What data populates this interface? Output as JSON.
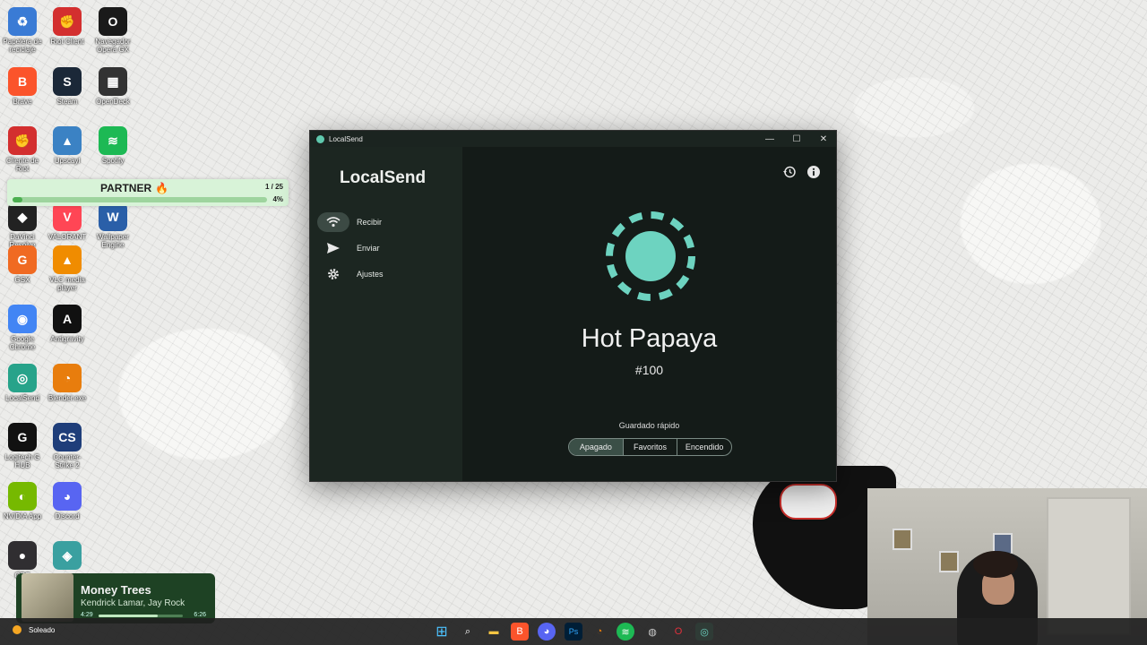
{
  "desktop_icons": [
    {
      "label": "Papelera de reciclaje",
      "icon": "recycle-bin-icon",
      "color": "#3a7bd5",
      "glyph": "♻"
    },
    {
      "label": "Riot Client",
      "icon": "riot-client-icon",
      "color": "#d32f2f",
      "glyph": "✊"
    },
    {
      "label": "Navegador Opera GX",
      "icon": "opera-gx-icon",
      "color": "#1a1a1a",
      "glyph": "O"
    },
    {
      "label": "Brave",
      "icon": "brave-icon",
      "color": "#fb542b",
      "glyph": "B"
    },
    {
      "label": "Steam",
      "icon": "steam-icon",
      "color": "#1b2838",
      "glyph": "S"
    },
    {
      "label": "OpenDeck",
      "icon": "opendeck-icon",
      "color": "#333",
      "glyph": "▦"
    },
    {
      "label": "Cliente de Riot",
      "icon": "riot-client-icon",
      "color": "#d32f2f",
      "glyph": "✊"
    },
    {
      "label": "Upscayl",
      "icon": "upscayl-icon",
      "color": "#3b82c4",
      "glyph": "▲"
    },
    {
      "label": "Spotify",
      "icon": "spotify-icon",
      "color": "#1db954",
      "glyph": "≋"
    },
    {
      "label": "DaVinci Resolve",
      "icon": "davinci-icon",
      "color": "#222",
      "glyph": "◆"
    },
    {
      "label": "VALORANT",
      "icon": "valorant-icon",
      "color": "#ff4655",
      "glyph": "V"
    },
    {
      "label": "Wallpaper Engine",
      "icon": "wallpaper-engine-icon",
      "color": "#2a5fa8",
      "glyph": "W"
    },
    {
      "label": "GSX",
      "icon": "gsx-icon",
      "color": "#f06a22",
      "glyph": "G"
    },
    {
      "label": "VLC media player",
      "icon": "vlc-icon",
      "color": "#f08c00",
      "glyph": "▲"
    },
    {
      "label": "Google Chrome",
      "icon": "chrome-icon",
      "color": "#4285f4",
      "glyph": "◉"
    },
    {
      "label": "Antigravity",
      "icon": "antigravity-icon",
      "color": "#111",
      "glyph": "A"
    },
    {
      "label": "LocalSend",
      "icon": "localsend-icon",
      "color": "#27a38a",
      "glyph": "◎"
    },
    {
      "label": "Blender.exe",
      "icon": "blender-icon",
      "color": "#e87d0d",
      "glyph": "◔"
    },
    {
      "label": "Logitech G HUB",
      "icon": "logitech-ghub-icon",
      "color": "#111",
      "glyph": "G"
    },
    {
      "label": "Counter-Strike 2",
      "icon": "counter-strike-icon",
      "color": "#1f3e7a",
      "glyph": "CS"
    },
    {
      "label": "NVIDIA App",
      "icon": "nvidia-icon",
      "color": "#76b900",
      "glyph": "◐"
    },
    {
      "label": "Discord",
      "icon": "discord-icon",
      "color": "#5865f2",
      "glyph": "◕"
    },
    {
      "label": "OBS",
      "icon": "obs-icon",
      "color": "#302e31",
      "glyph": "●"
    },
    {
      "label": "",
      "icon": "app-icon",
      "color": "#3aa0a0",
      "glyph": "◈"
    }
  ],
  "partner_widget": {
    "title": "PARTNER",
    "count": "1 / 25",
    "percent": "4%",
    "progress": 0.04
  },
  "window": {
    "title": "LocalSend",
    "brand": "LocalSend",
    "nav": [
      {
        "label": "Recibir",
        "icon": "wifi-icon",
        "active": true
      },
      {
        "label": "Enviar",
        "icon": "send-icon",
        "active": false
      },
      {
        "label": "Ajustes",
        "icon": "gear-icon",
        "active": false
      }
    ],
    "device_name": "Hot Papaya",
    "device_number": "#100",
    "quick_save_label": "Guardado rápido",
    "quick_save_options": [
      "Apagado",
      "Favoritos",
      "Encendido"
    ],
    "quick_save_selected": "Apagado",
    "accent": "#6dd3c0"
  },
  "music": {
    "song": "Money Trees",
    "artist": "Kendrick Lamar, Jay Rock",
    "elapsed": "4:29",
    "total": "6:26",
    "progress": 0.7
  },
  "taskbar": {
    "weather": "Soleado"
  }
}
